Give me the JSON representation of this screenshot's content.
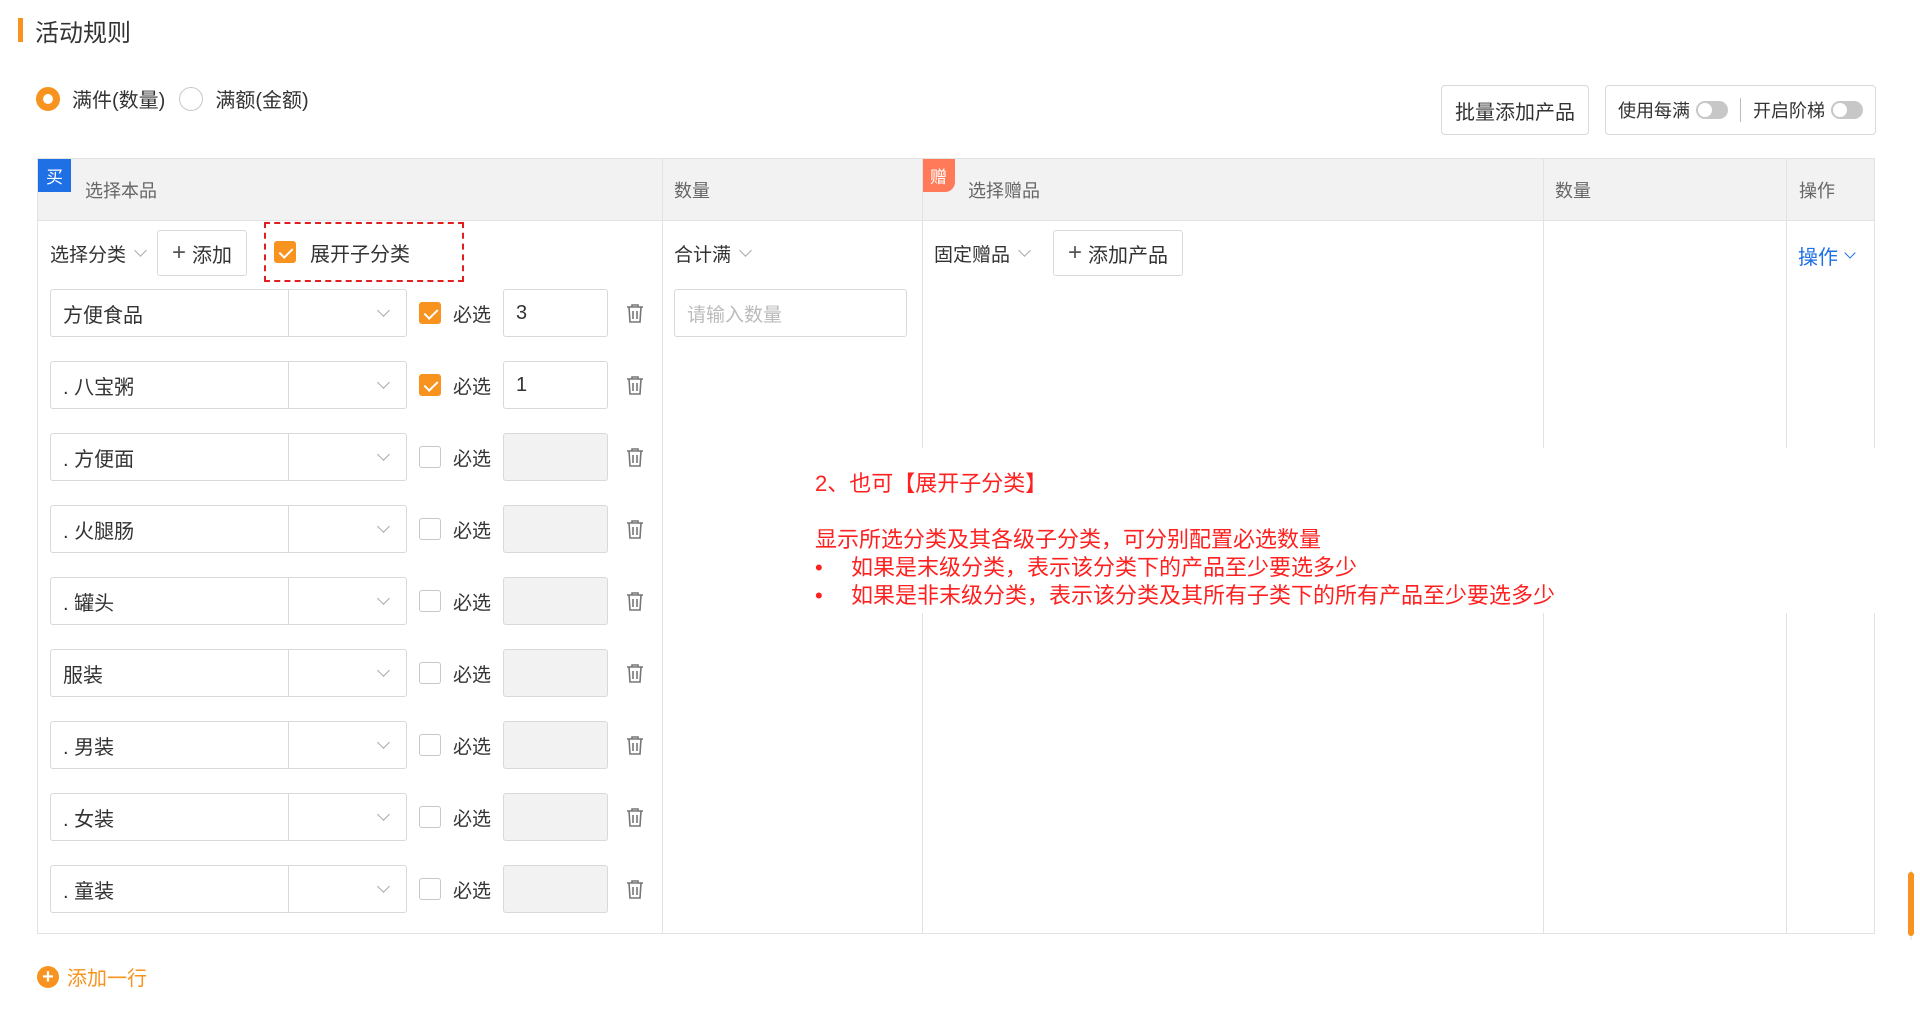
{
  "section_title": "活动规则",
  "modes": [
    {
      "label": "满件(数量)",
      "selected": true
    },
    {
      "label": "满额(金额)",
      "selected": false
    }
  ],
  "top_buttons": {
    "batch_add": "批量添加产品",
    "per_full_label": "使用每满",
    "per_full_on": false,
    "tier_label": "开启阶梯",
    "tier_on": false
  },
  "table": {
    "buy_tag": "买",
    "gift_tag": "赠",
    "headers": {
      "select_product": "选择本品",
      "qty1": "数量",
      "select_gift": "选择赠品",
      "qty2": "数量",
      "op": "操作"
    },
    "controls": {
      "select_category": "选择分类",
      "add_label": "添加",
      "expand_label": "展开子分类",
      "expand_checked": true,
      "total_full": "合计满",
      "qty_placeholder": "请输入数量",
      "fixed_gift": "固定赠品",
      "add_product": "添加产品",
      "op_label": "操作"
    },
    "required_label": "必选",
    "rows": [
      {
        "name": "方便食品",
        "required": true,
        "qty": "3"
      },
      {
        "name": ". 八宝粥",
        "required": true,
        "qty": "1"
      },
      {
        "name": ". 方便面",
        "required": false,
        "qty": ""
      },
      {
        "name": ". 火腿肠",
        "required": false,
        "qty": ""
      },
      {
        "name": ". 罐头",
        "required": false,
        "qty": ""
      },
      {
        "name": "服装",
        "required": false,
        "qty": ""
      },
      {
        "name": ". 男装",
        "required": false,
        "qty": ""
      },
      {
        "name": ". 女装",
        "required": false,
        "qty": ""
      },
      {
        "name": ". 童装",
        "required": false,
        "qty": ""
      }
    ]
  },
  "note": {
    "title": "2、也可【展开子分类】",
    "line": "显示所选分类及其各级子分类，可分别配置必选数量",
    "bullet_char": "•",
    "bullets": [
      "如果是末级分类，表示该分类下的产品至少要选多少",
      "如果是非末级分类，表示该分类及其所有子类下的所有产品至少要选多少"
    ]
  },
  "add_row_label": "添加一行",
  "colors": {
    "accent": "#f7931e",
    "link": "#1f6fe5",
    "annotation": "#ff2020",
    "gift_tag": "#ff7a59"
  },
  "icons": [
    "radio-icon",
    "switch-icon",
    "chevron-down-icon",
    "plus-icon",
    "check-icon",
    "trash-icon",
    "plus-circle-icon"
  ]
}
